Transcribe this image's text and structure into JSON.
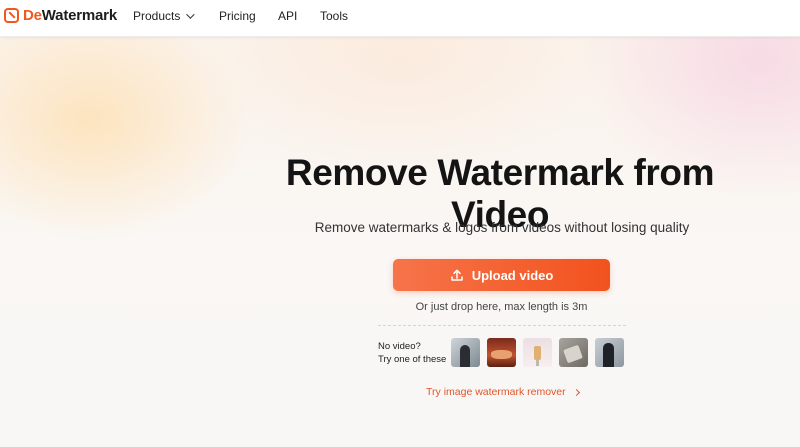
{
  "navbar": {
    "logo": {
      "prefix": "De",
      "suffix": "Watermark"
    },
    "items": [
      {
        "label": "Products",
        "has_dropdown": true
      },
      {
        "label": "Pricing"
      },
      {
        "label": "API"
      },
      {
        "label": "Tools"
      }
    ]
  },
  "hero": {
    "title": "Remove Watermark from Video",
    "subtitle": "Remove watermarks & logos from videos without losing quality",
    "upload_label": "Upload video",
    "drop_hint": "Or just drop here, max length is 3m",
    "samples": {
      "line1": "No video?",
      "line2": "Try one of these",
      "thumbs": [
        "sample-video-1",
        "sample-video-2",
        "sample-video-3",
        "sample-video-4",
        "sample-video-5"
      ]
    },
    "image_link": "Try image watermark remover"
  },
  "colors": {
    "accent": "#f3561f",
    "link": "#e0562a",
    "text": "#141414"
  }
}
